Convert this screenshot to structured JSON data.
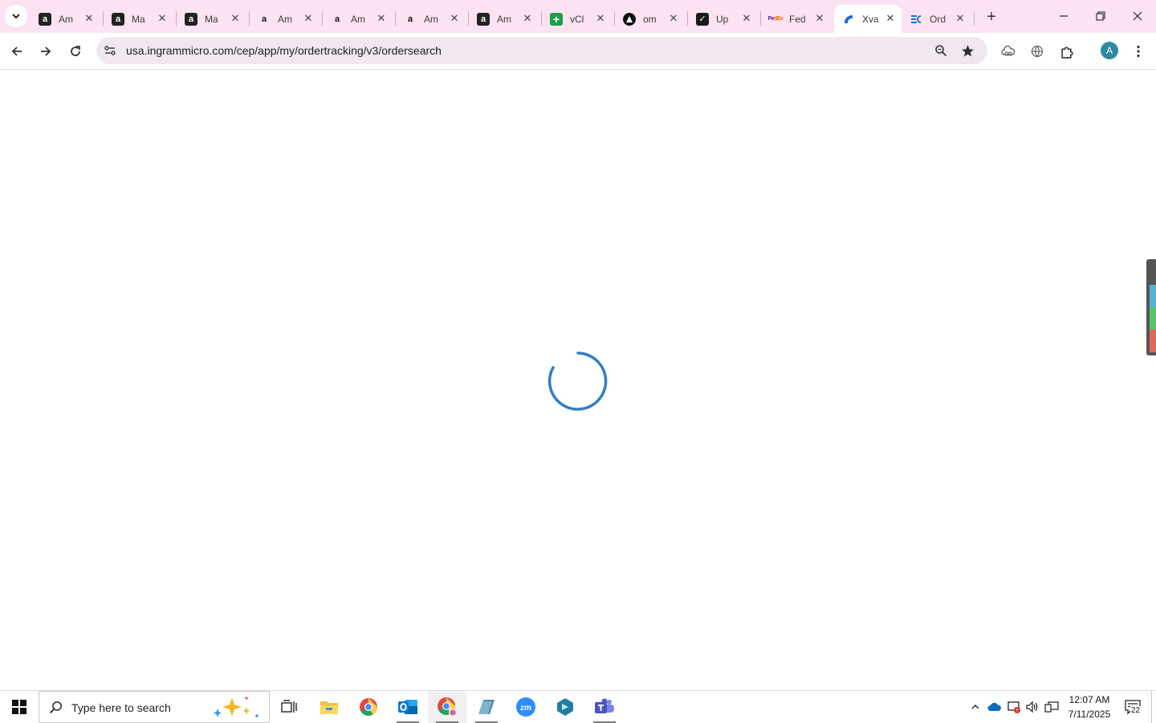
{
  "browser": {
    "tabs": [
      {
        "title": "Am",
        "favicon": "amazon-icon",
        "active": false
      },
      {
        "title": "Ma",
        "favicon": "amazon-icon",
        "active": false
      },
      {
        "title": "Ma",
        "favicon": "amazon-icon",
        "active": false
      },
      {
        "title": "Am",
        "favicon": "amazon-smile-icon",
        "active": false
      },
      {
        "title": "Am",
        "favicon": "amazon-smile-icon",
        "active": false
      },
      {
        "title": "Am",
        "favicon": "amazon-smile-icon",
        "active": false
      },
      {
        "title": "Am",
        "favicon": "amazon-icon",
        "active": false
      },
      {
        "title": "vCl",
        "favicon": "plus-sheet-icon",
        "active": false
      },
      {
        "title": "om",
        "favicon": "triangle-logo-icon",
        "active": false
      },
      {
        "title": "Up",
        "favicon": "checkmark-logo-icon",
        "active": false
      },
      {
        "title": "Fed",
        "favicon": "fedex-icon",
        "active": false
      },
      {
        "title": "Xva",
        "favicon": "ingram-micro-icon",
        "active": true
      },
      {
        "title": "Ord",
        "favicon": "ingram-micro-icon",
        "active": false
      }
    ],
    "address": {
      "url": "usa.ingrammicro.com/cep/app/my/ordertracking/v3/ordersearch"
    },
    "profile_initial": "A"
  },
  "page": {
    "state": "loading",
    "spinner_color": "#2f7dc7"
  },
  "taskbar": {
    "search_placeholder": "Type here to search",
    "apps": [
      "task-view-icon",
      "file-explorer-icon",
      "chrome-icon",
      "outlook-icon",
      "chrome-profile-icon",
      "app-icon",
      "zoom-icon",
      "app-icon",
      "teams-icon"
    ],
    "time": "12:07 AM",
    "date": "7/11/2025",
    "notification_count": "22"
  }
}
